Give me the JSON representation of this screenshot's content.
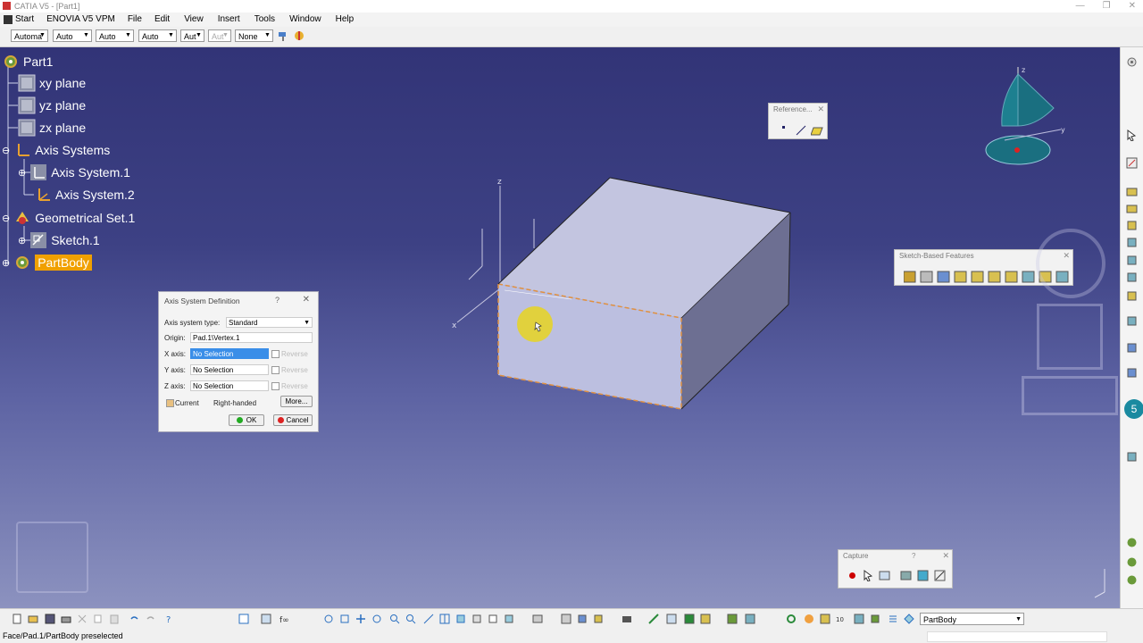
{
  "window": {
    "title": "CATIA V5 - [Part1]"
  },
  "menu": {
    "items": [
      "Start",
      "ENOVIA V5 VPM",
      "File",
      "Edit",
      "View",
      "Insert",
      "Tools",
      "Window",
      "Help"
    ]
  },
  "toolbar": {
    "combos": [
      "Automa",
      "Auto",
      "Auto",
      "Auto",
      "Aut",
      "Aut",
      "None"
    ]
  },
  "tree": {
    "root": "Part1",
    "nodes": [
      "xy plane",
      "yz plane",
      "zx plane",
      "Axis Systems",
      "Axis System.1",
      "Axis System.2",
      "Geometrical Set.1",
      "Sketch.1",
      "PartBody"
    ]
  },
  "reference_toolbar": {
    "title": "Reference..."
  },
  "sketch_toolbar": {
    "title": "Sketch-Based Features"
  },
  "capture_toolbar": {
    "title": "Capture",
    "help": "?"
  },
  "dialog": {
    "title": "Axis System Definition",
    "help": "?",
    "type_label": "Axis system type:",
    "type_value": "Standard",
    "origin_label": "Origin:",
    "origin_value": "Pad.1\\Vertex.1",
    "x_label": "X axis:",
    "x_value": "No Selection",
    "y_label": "Y axis:",
    "y_value": "No Selection",
    "z_label": "Z axis:",
    "z_value": "No Selection",
    "reverse": "Reverse",
    "current": "Current",
    "handed": "Right-handed",
    "more": "More...",
    "ok": "OK",
    "cancel": "Cancel"
  },
  "bottom": {
    "current_body": "PartBody"
  },
  "status": {
    "text": "Face/Pad.1/PartBody preselected"
  },
  "compass_labels": {
    "z": "z",
    "y": "y"
  },
  "axis_labels": {
    "z": "z",
    "x": "x"
  },
  "side_badge": "5",
  "colors": {
    "viewport_top": "#323477",
    "viewport_bottom": "#8c92bf",
    "highlight": "#f0a000",
    "selection": "#3a8ee8"
  }
}
